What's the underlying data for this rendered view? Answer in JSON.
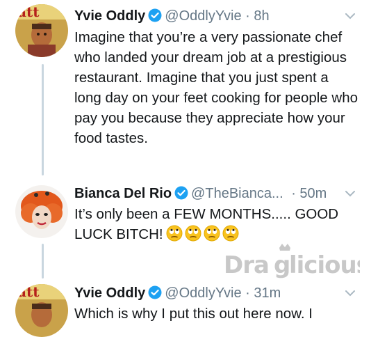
{
  "tweets": [
    {
      "name": "Yvie Oddly",
      "handle": "@OddlyYvie",
      "separator": "·",
      "time": "8h",
      "text": "Imagine that you’re a very passionate chef who landed your dream job at a prestigious restaurant. Imagine that you just spent a long day on your feet cooking for people who pay you because they appreciate how your food tastes.",
      "avatar_icon": "magazine-cover-avatar"
    },
    {
      "name": "Bianca Del Rio",
      "handle": "@TheBianca...",
      "separator": "·",
      "time": "50m",
      "text": "It’s only been a FEW MONTHS..... GOOD LUCK BITCH!",
      "emojis": [
        "eye-roll-emoji",
        "eye-roll-emoji",
        "eye-roll-emoji",
        "eye-roll-emoji"
      ],
      "avatar_icon": "drag-queen-avatar"
    },
    {
      "name": "Yvie Oddly",
      "handle": "@OddlyYvie",
      "separator": "·",
      "time": "31m",
      "text": "Which is why I put this out here now. I",
      "avatar_icon": "magazine-cover-avatar"
    }
  ],
  "watermark": {
    "text": "Dra licious",
    "brand": "Draglicious"
  },
  "colors": {
    "verified_blue": "#1da1f2",
    "muted_text": "#657786",
    "thread_line": "#c9d6df",
    "watermark_gray": "#c8c8c8"
  }
}
